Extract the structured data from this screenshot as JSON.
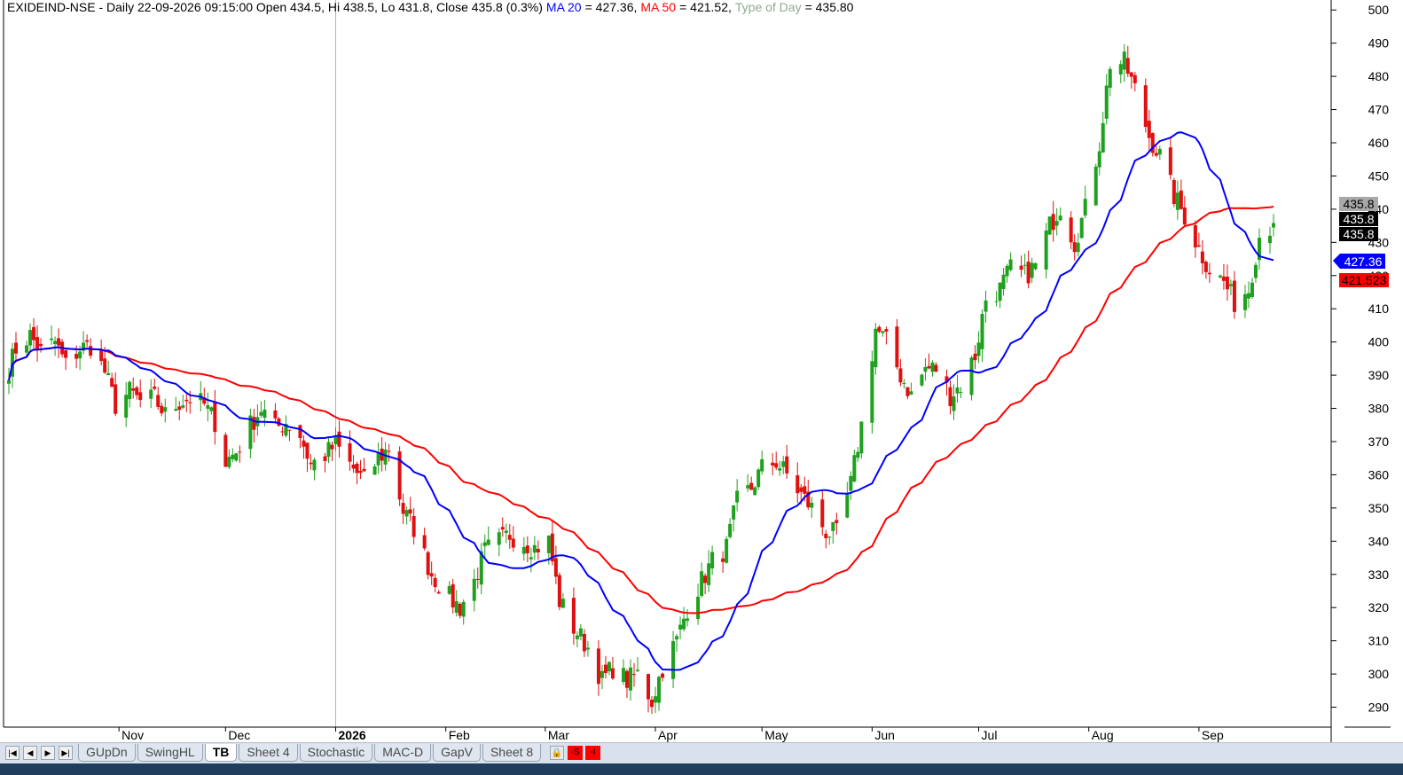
{
  "header": {
    "symbol_info": "EXIDEIND-NSE - Daily 22-09-2026 09:15:00 Open 434.5, Hi 438.5, Lo 431.8, Close 435.8 (0.3%)",
    "ma20_label": "MA 20",
    "ma20_value": "= 427.36,",
    "ma50_label": "MA 50",
    "ma50_value": "= 421.52,",
    "tod_label": "Type of Day",
    "tod_value": "= 435.80"
  },
  "price_tags": {
    "top": "435.8",
    "mid": "435.8",
    "low": "435.8",
    "ma20": "427.36",
    "ma50": "421.523"
  },
  "sheet_tabs": {
    "nav_icons": [
      "first-sheet-icon",
      "prev-sheet-icon",
      "next-sheet-icon",
      "last-sheet-icon"
    ],
    "tabs": [
      "GUpDn",
      "SwingHL",
      "TB",
      "Sheet 4",
      "Stochastic",
      "MAC-D",
      "GapV",
      "Sheet 8"
    ],
    "active": "TB",
    "extra_buttons": [
      "-S",
      "-I"
    ]
  },
  "colors": {
    "up_candle": "#1fa01f",
    "down_candle": "#e01010",
    "ma20_line": "#0000ff",
    "ma50_line": "#ff0000",
    "type_of_day": "#8faa8f",
    "price_tag_gray": "#a8a8a8",
    "price_tag_black": "#000000"
  },
  "chart_data": {
    "type": "candlestick",
    "title": "EXIDEIND-NSE - Daily",
    "ylim": [
      284,
      503
    ],
    "y_ticks": [
      290,
      300,
      310,
      320,
      330,
      340,
      350,
      360,
      370,
      380,
      390,
      400,
      410,
      420,
      430,
      440,
      450,
      460,
      470,
      480,
      490,
      500
    ],
    "y_tick_labels": [
      "290",
      "300",
      "310",
      "320",
      "330",
      "340",
      "350",
      "360",
      "370",
      "380",
      "390",
      "400",
      "410",
      "420",
      "430",
      "440",
      "450",
      "460",
      "470",
      "480",
      "490",
      "500"
    ],
    "x_range": [
      "2025-10-01",
      "2026-10-12"
    ],
    "month_labels": [
      {
        "label": "Nov",
        "date": "2025-11-01"
      },
      {
        "label": "Dec",
        "date": "2025-12-01"
      },
      {
        "label": "2026",
        "date": "2026-01-01",
        "bold": true
      },
      {
        "label": "Feb",
        "date": "2026-02-01"
      },
      {
        "label": "Mar",
        "date": "2026-03-01"
      },
      {
        "label": "Apr",
        "date": "2026-04-01"
      },
      {
        "label": "May",
        "date": "2026-05-01"
      },
      {
        "label": "Jun",
        "date": "2026-06-01"
      },
      {
        "label": "Jul",
        "date": "2026-07-01"
      },
      {
        "label": "Aug",
        "date": "2026-08-01"
      },
      {
        "label": "Sep",
        "date": "2026-09-01"
      }
    ],
    "separator_date": "2026-01-01",
    "last_candle": {
      "date": "2026-09-22",
      "open": 434.5,
      "high": 438.5,
      "low": 431.8,
      "close": 435.8
    },
    "close_anchors": [
      [
        "2025-10-01",
        392
      ],
      [
        "2025-10-03",
        398
      ],
      [
        "2025-10-07",
        402
      ],
      [
        "2025-10-10",
        397
      ],
      [
        "2025-10-14",
        400
      ],
      [
        "2025-10-17",
        393
      ],
      [
        "2025-10-21",
        398
      ],
      [
        "2025-10-24",
        399
      ],
      [
        "2025-10-28",
        391
      ],
      [
        "2025-10-31",
        381
      ],
      [
        "2025-11-04",
        385
      ],
      [
        "2025-11-07",
        382
      ],
      [
        "2025-11-11",
        383
      ],
      [
        "2025-11-14",
        378
      ],
      [
        "2025-11-18",
        382
      ],
      [
        "2025-11-21",
        383
      ],
      [
        "2025-11-25",
        381
      ],
      [
        "2025-11-28",
        376
      ],
      [
        "2025-12-01",
        364
      ],
      [
        "2025-12-04",
        367
      ],
      [
        "2025-12-08",
        375
      ],
      [
        "2025-12-11",
        380
      ],
      [
        "2025-12-15",
        374
      ],
      [
        "2025-12-18",
        376
      ],
      [
        "2025-12-22",
        372
      ],
      [
        "2025-12-25",
        363
      ],
      [
        "2025-12-29",
        366
      ],
      [
        "2026-01-01",
        369
      ],
      [
        "2026-01-05",
        363
      ],
      [
        "2026-01-09",
        358
      ],
      [
        "2026-01-13",
        365
      ],
      [
        "2026-01-16",
        368
      ],
      [
        "2026-01-20",
        349
      ],
      [
        "2026-01-23",
        344
      ],
      [
        "2026-01-28",
        330
      ],
      [
        "2026-02-02",
        323
      ],
      [
        "2026-02-05",
        320
      ],
      [
        "2026-02-09",
        328
      ],
      [
        "2026-02-12",
        337
      ],
      [
        "2026-02-16",
        340
      ],
      [
        "2026-02-19",
        342
      ],
      [
        "2026-02-23",
        340
      ],
      [
        "2026-02-26",
        338
      ],
      [
        "2026-03-02",
        340
      ],
      [
        "2026-03-05",
        322
      ],
      [
        "2026-03-09",
        314
      ],
      [
        "2026-03-13",
        308
      ],
      [
        "2026-03-17",
        298
      ],
      [
        "2026-03-20",
        302
      ],
      [
        "2026-03-24",
        298
      ],
      [
        "2026-03-27",
        300
      ],
      [
        "2026-03-31",
        292
      ],
      [
        "2026-04-03",
        302
      ],
      [
        "2026-04-07",
        310
      ],
      [
        "2026-04-10",
        320
      ],
      [
        "2026-04-14",
        328
      ],
      [
        "2026-04-17",
        334
      ],
      [
        "2026-04-21",
        338
      ],
      [
        "2026-04-24",
        352
      ],
      [
        "2026-04-28",
        356
      ],
      [
        "2026-05-01",
        362
      ],
      [
        "2026-05-05",
        364
      ],
      [
        "2026-05-08",
        360
      ],
      [
        "2026-05-12",
        354
      ],
      [
        "2026-05-15",
        350
      ],
      [
        "2026-05-19",
        343
      ],
      [
        "2026-05-22",
        342
      ],
      [
        "2026-05-26",
        357
      ],
      [
        "2026-05-29",
        375
      ],
      [
        "2026-06-02",
        404
      ],
      [
        "2026-06-05",
        400
      ],
      [
        "2026-06-09",
        390
      ],
      [
        "2026-06-12",
        384
      ],
      [
        "2026-06-16",
        392
      ],
      [
        "2026-06-19",
        392
      ],
      [
        "2026-06-23",
        384
      ],
      [
        "2026-06-26",
        387
      ],
      [
        "2026-06-30",
        396
      ],
      [
        "2026-07-03",
        413
      ],
      [
        "2026-07-07",
        416
      ],
      [
        "2026-07-10",
        422
      ],
      [
        "2026-07-14",
        420
      ],
      [
        "2026-07-17",
        423
      ],
      [
        "2026-07-21",
        435
      ],
      [
        "2026-07-24",
        441
      ],
      [
        "2026-07-28",
        430
      ],
      [
        "2026-07-31",
        440
      ],
      [
        "2026-08-04",
        460
      ],
      [
        "2026-08-07",
        484
      ],
      [
        "2026-08-11",
        484
      ],
      [
        "2026-08-14",
        476
      ],
      [
        "2026-08-18",
        462
      ],
      [
        "2026-08-21",
        456
      ],
      [
        "2026-08-25",
        444
      ],
      [
        "2026-08-28",
        438
      ],
      [
        "2026-09-01",
        428
      ],
      [
        "2026-09-04",
        422
      ],
      [
        "2026-09-08",
        418
      ],
      [
        "2026-09-11",
        412
      ],
      [
        "2026-09-15",
        416
      ],
      [
        "2026-09-18",
        432
      ],
      [
        "2026-09-22",
        435.8
      ]
    ]
  }
}
